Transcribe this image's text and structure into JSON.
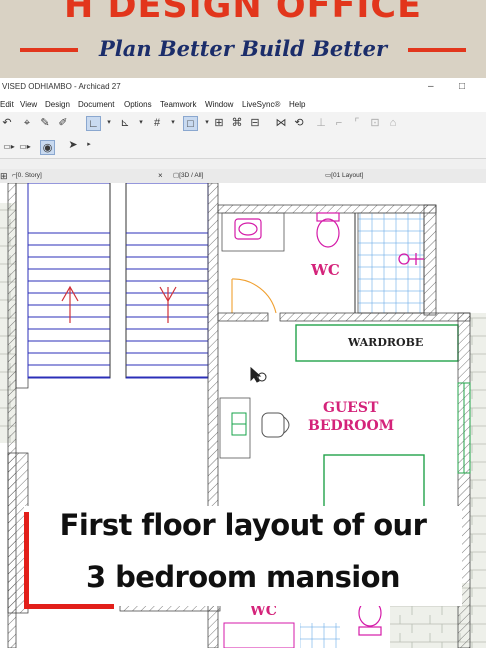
{
  "banner": {
    "title": "H DESIGN OFFICE",
    "tagline": "Plan Better Build Better",
    "title_color": "#e2361c",
    "tagline_color": "#1b2d6a"
  },
  "window": {
    "title": "VISED ODHIAMBO - Archicad 27",
    "controls": [
      "–",
      "□"
    ]
  },
  "menu": [
    "Edit",
    "View",
    "Design",
    "Document",
    "Options",
    "Teamwork",
    "Window",
    "LiveSync®",
    "Help"
  ],
  "tabs": [
    {
      "label": "[0. Story]",
      "close": "×"
    },
    {
      "label": "[3D / All]"
    },
    {
      "label": "[01 Layout]"
    }
  ],
  "rooms": {
    "wc_upper": "WC",
    "wardrobe": "WARDROBE",
    "guest_line1": "GUEST",
    "guest_line2": "BEDROOM",
    "wc_lower": "WC"
  },
  "caption": {
    "line1": "First floor layout of our",
    "line2": "3 bedroom mansion",
    "accent_color": "#e21f1a"
  },
  "colors": {
    "room_label": "#d4237a",
    "fixture": "#d41aa8",
    "stair_lines": "#2b2fb8",
    "tile_grid": "#6aa9e8",
    "wardrobe_outline": "#22a34a"
  }
}
